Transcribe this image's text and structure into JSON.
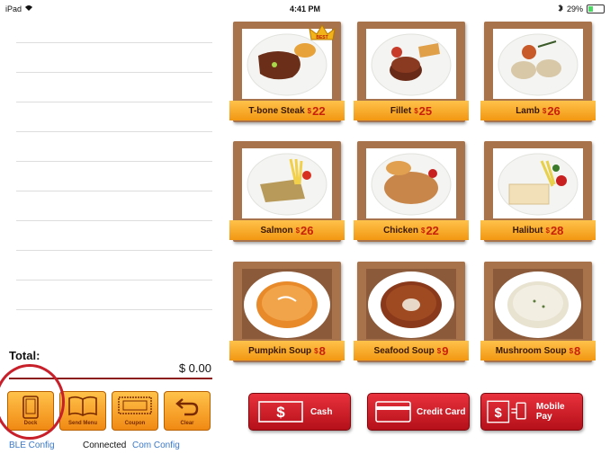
{
  "status_bar": {
    "device": "iPad",
    "time": "4:41 PM",
    "battery": "29%",
    "battery_level": 0.29
  },
  "order": {
    "total_label": "Total:",
    "total_value": "$ 0.00",
    "line_count": 10
  },
  "actions": [
    {
      "label": "Dock",
      "icon": "tablet-icon"
    },
    {
      "label": "Send Menu",
      "icon": "open-book-icon"
    },
    {
      "label": "Coupon",
      "icon": "coupon-icon"
    },
    {
      "label": "Clear",
      "icon": "undo-arrow-icon"
    }
  ],
  "footer": {
    "ble_link": "BLE Config",
    "connection_status": "Connected",
    "com_link": "Com Config"
  },
  "menu": [
    {
      "name": "T-bone Steak",
      "currency": "$",
      "price": "22",
      "badge": "BEST",
      "dish": "steak"
    },
    {
      "name": "Fillet",
      "currency": "$",
      "price": "25",
      "dish": "fillet"
    },
    {
      "name": "Lamb",
      "currency": "$",
      "price": "26",
      "dish": "lamb"
    },
    {
      "name": "Salmon",
      "currency": "$",
      "price": "26",
      "dish": "salmon"
    },
    {
      "name": "Chicken",
      "currency": "$",
      "price": "22",
      "dish": "chicken"
    },
    {
      "name": "Halibut",
      "currency": "$",
      "price": "28",
      "dish": "halibut"
    },
    {
      "name": "Pumpkin Soup",
      "currency": "$",
      "price": "8",
      "dish": "pumpkin-soup"
    },
    {
      "name": "Seafood Soup",
      "currency": "$",
      "price": "9",
      "dish": "seafood-soup"
    },
    {
      "name": "Mushroom Soup",
      "currency": "$",
      "price": "8",
      "dish": "mushroom-soup"
    }
  ],
  "payments": [
    {
      "label": "Cash",
      "icon": "cash-icon"
    },
    {
      "label": "Credit Card",
      "icon": "credit-card-icon"
    },
    {
      "label": "Mobile Pay",
      "icon": "mobile-pay-icon"
    }
  ],
  "colors": {
    "ribbon": "#f29712",
    "frame": "#a8724a",
    "pay_button": "#c8202a",
    "highlight_circle": "#c8202a",
    "link": "#3a78c8"
  }
}
